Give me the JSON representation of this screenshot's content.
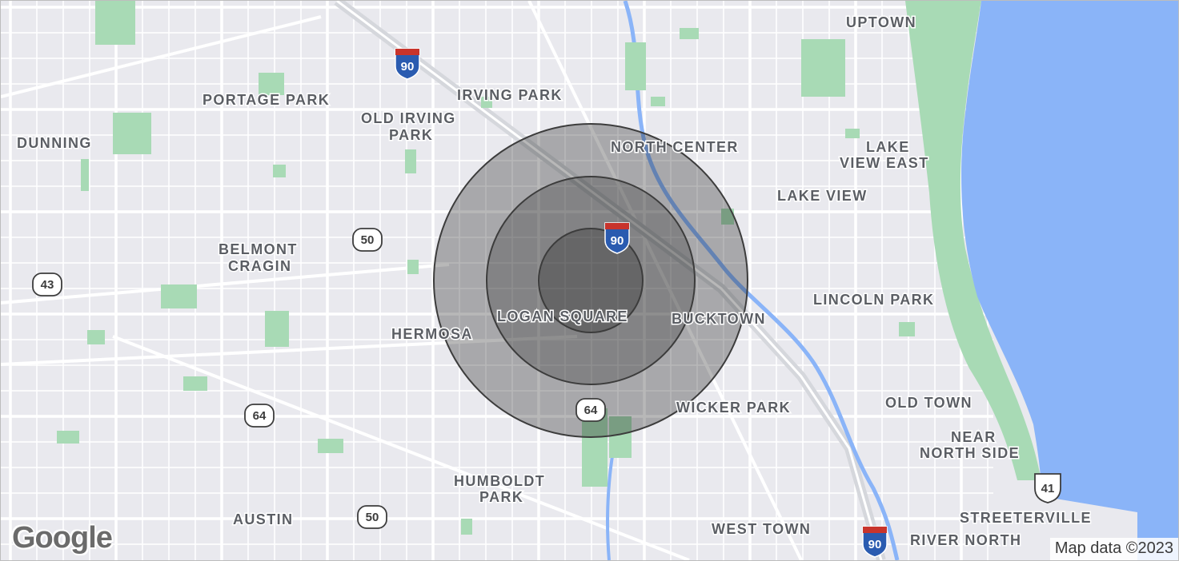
{
  "map": {
    "attribution": "Map data ©2023",
    "logo_text": "Google",
    "colors": {
      "land": "#e9e9ee",
      "water": "#8ab4f8",
      "park": "#a8dab5",
      "road": "#ffffff",
      "highway": "#d5d7dc",
      "radius_fill": "#000000",
      "radius_stroke": "#3c3c3c"
    },
    "radius_rings": 3,
    "neighborhoods": {
      "uptown": "UPTOWN",
      "portage_park": "PORTAGE PARK",
      "irving_park": "IRVING PARK",
      "old_irving_1": "OLD IRVING",
      "old_irving_2": "PARK",
      "dunning": "DUNNING",
      "north_center": "NORTH CENTER",
      "lake_view_east_1": "LAKE",
      "lake_view_east_2": "VIEW EAST",
      "lake_view": "LAKE VIEW",
      "belmont_1": "BELMONT",
      "belmont_2": "CRAGIN",
      "lincoln_park": "LINCOLN PARK",
      "hermosa": "HERMOSA",
      "logan_square": "LOGAN SQUARE",
      "bucktown": "BUCKTOWN",
      "wicker_park": "WICKER PARK",
      "old_town": "OLD TOWN",
      "near_north_1": "NEAR",
      "near_north_2": "NORTH SIDE",
      "humboldt_1": "HUMBOLDT",
      "humboldt_2": "PARK",
      "austin": "AUSTIN",
      "streeterville": "STREETERVILLE",
      "west_town": "WEST TOWN",
      "river_north": "RIVER NORTH"
    },
    "route_shields": {
      "i90_top": "90",
      "i90_center": "90",
      "i90_bottom": "90",
      "r50_a": "50",
      "r50_b": "50",
      "r43": "43",
      "r64_a": "64",
      "r64_b": "64",
      "us41": "41"
    }
  }
}
